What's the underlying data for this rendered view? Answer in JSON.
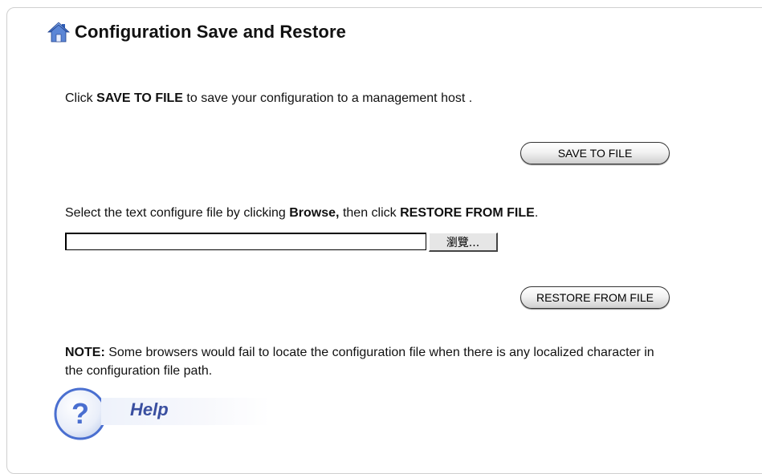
{
  "page": {
    "title": "Configuration Save and Restore"
  },
  "save": {
    "instruction_pre": "Click ",
    "instruction_bold": "SAVE TO FILE",
    "instruction_post": " to save your configuration to a management host .",
    "button_label": "SAVE TO FILE"
  },
  "restore": {
    "instruction_pre": "Select the text configure file by clicking ",
    "instruction_bold1": "Browse,",
    "instruction_mid": " then click ",
    "instruction_bold2": "RESTORE FROM FILE",
    "instruction_post": ".",
    "file_value": "",
    "browse_label": "瀏覽...",
    "button_label": "RESTORE FROM FILE"
  },
  "note": {
    "label": "NOTE:",
    "text": " Some browsers would fail to locate the configuration file when there is any localized character in the configuration file path."
  },
  "help": {
    "label": "Help"
  },
  "icons": {
    "title_icon": "home-icon",
    "help_icon": "help-question-icon"
  },
  "colors": {
    "help_text": "#3a4fa0",
    "help_circle": "#4a6fd0"
  }
}
